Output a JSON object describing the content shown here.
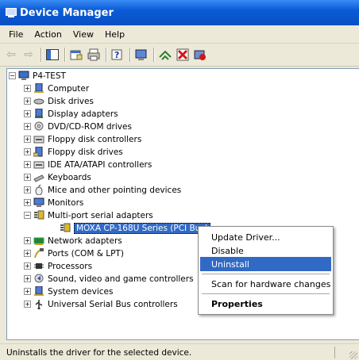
{
  "window": {
    "title": "Device Manager"
  },
  "menu": {
    "items": [
      "File",
      "Action",
      "View",
      "Help"
    ]
  },
  "toolbar": {
    "buttons": [
      "back-icon",
      "forward-icon",
      "show-hide-console-tree-icon",
      "properties-icon",
      "print-icon",
      "help-icon",
      "scan-hardware-icon",
      "update-driver-icon",
      "uninstall-icon",
      "disable-icon"
    ]
  },
  "tree": {
    "root": "P4-TEST",
    "categories": [
      "Computer",
      "Disk drives",
      "Display adapters",
      "DVD/CD-ROM drives",
      "Floppy disk controllers",
      "Floppy disk drives",
      "IDE ATA/ATAPI controllers",
      "Keyboards",
      "Mice and other pointing devices",
      "Monitors",
      "Multi-port serial adapters",
      "MOXA CP-168U Series (PCI Bus)",
      "Network adapters",
      "Ports (COM & LPT)",
      "Processors",
      "Sound, video and game controllers",
      "System devices",
      "Universal Serial Bus controllers"
    ]
  },
  "context_menu": {
    "items": [
      "Update Driver...",
      "Disable",
      "Uninstall",
      "Scan for hardware changes",
      "Properties"
    ],
    "highlighted": "Uninstall"
  },
  "status": {
    "text": "Uninstalls the driver for the selected device."
  },
  "colors": {
    "title_bar": "#0a4fc4",
    "selection": "#316ac5",
    "menu_bg": "#ece9d8"
  }
}
